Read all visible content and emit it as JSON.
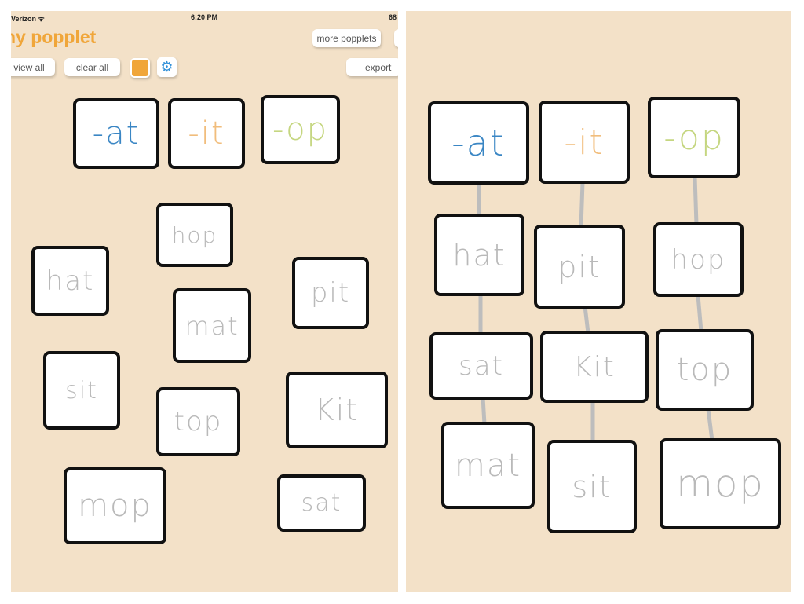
{
  "status_bar": {
    "carrier": "Verizon ᯤ",
    "time": "6:20 PM",
    "battery": "68"
  },
  "app_title": "ny popplet",
  "toolbar": {
    "view_all": "view all",
    "clear_all": "clear all",
    "color_swatch": "#f0a63a",
    "settings_icon": "gear-icon",
    "more_popplets": "more popplets",
    "export": "export"
  },
  "colors": {
    "at": "#3a86c4",
    "it": "#f1bd7c",
    "op": "#c5d680",
    "word": "#b9b9b9",
    "background": "#f3e1c8",
    "connector": "#bdbdbd"
  },
  "left_popples": [
    "-at",
    "-it",
    "-op",
    "hop",
    "hat",
    "pit",
    "mat",
    "sit",
    "top",
    "Kit",
    "mop",
    "sat"
  ],
  "right_popples": [
    "-at",
    "-it",
    "-op",
    "hat",
    "pit",
    "hop",
    "sat",
    "Kit",
    "top",
    "mat",
    "sit",
    "mop"
  ]
}
